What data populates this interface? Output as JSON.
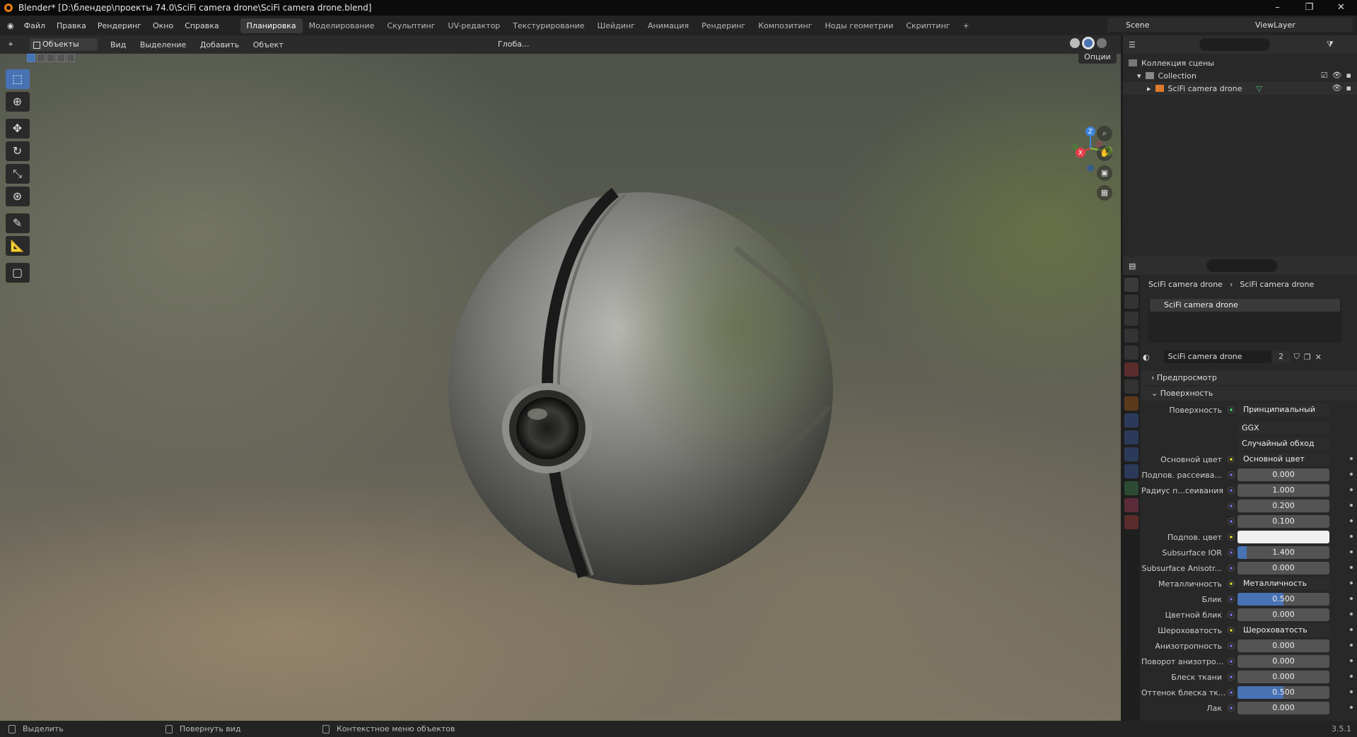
{
  "title": "Blender* [D:\\блендер\\проекты 74.0\\SciFi camera drone\\SciFi camera drone.blend]",
  "menu": [
    "Файл",
    "Правка",
    "Рендеринг",
    "Окно",
    "Справка"
  ],
  "workspaces": [
    "Планировка",
    "Моделирование",
    "Скульптинг",
    "UV-редактор",
    "Текстурирование",
    "Шейдинг",
    "Анимация",
    "Рендеринг",
    "Композитинг",
    "Ноды геометрии",
    "Скриптинг"
  ],
  "scene": "Scene",
  "view_layer": "ViewLayer",
  "viewport_header": {
    "mode": "Объекты",
    "menus": [
      "Вид",
      "Выделение",
      "Добавить",
      "Объект"
    ],
    "orientation": "Глоба...",
    "options": "Опции"
  },
  "gizmo": {
    "x": "X",
    "y": "Y",
    "z": "Z"
  },
  "outliner": {
    "root": "Коллекция сцены",
    "collection": "Collection",
    "object": "SciFi camera drone"
  },
  "properties": {
    "breadcrumb_object": "SciFi camera drone",
    "breadcrumb_material": "SciFi camera drone",
    "slot_name": "SciFi camera drone",
    "material_name": "SciFi camera drone",
    "material_users": "2",
    "panel_preview": "Предпросмотр",
    "panel_surface": "Поверхность",
    "surface_label": "Поверхность",
    "surface_value": "Принципиальный BSDF",
    "distribution": "GGX",
    "subsurface_method": "Случайный обход",
    "rows": [
      {
        "label": "Основной цвет",
        "value": "Основной цвет",
        "kind": "link"
      },
      {
        "label": "Подпов. рассеива...",
        "value": "0.000",
        "kind": "num",
        "fill": 0
      },
      {
        "label": "Радиус п...сеивания",
        "value": "1.000",
        "kind": "num",
        "fill": 0
      },
      {
        "label": "",
        "value": "0.200",
        "kind": "num",
        "fill": 0
      },
      {
        "label": "",
        "value": "0.100",
        "kind": "num",
        "fill": 0
      },
      {
        "label": "Подпов. цвет",
        "value": "",
        "kind": "color"
      },
      {
        "label": "Subsurface IOR",
        "value": "1.400",
        "kind": "num",
        "fill": 0.1
      },
      {
        "label": "Subsurface Anisotr...",
        "value": "0.000",
        "kind": "num",
        "fill": 0
      },
      {
        "label": "Металличность",
        "value": "Металличность",
        "kind": "link"
      },
      {
        "label": "Блик",
        "value": "0.500",
        "kind": "num",
        "fill": 0.5
      },
      {
        "label": "Цветной блик",
        "value": "0.000",
        "kind": "num",
        "fill": 0
      },
      {
        "label": "Шероховатость",
        "value": "Шероховатость",
        "kind": "link"
      },
      {
        "label": "Анизотропность",
        "value": "0.000",
        "kind": "num",
        "fill": 0
      },
      {
        "label": "Поворот анизотро...",
        "value": "0.000",
        "kind": "num",
        "fill": 0
      },
      {
        "label": "Блеск ткани",
        "value": "0.000",
        "kind": "num",
        "fill": 0
      },
      {
        "label": "Оттенок блеска тк...",
        "value": "0.500",
        "kind": "num",
        "fill": 0.5
      },
      {
        "label": "Лак",
        "value": "0.000",
        "kind": "num",
        "fill": 0
      }
    ]
  },
  "status": {
    "select": "Выделить",
    "rotate": "Повернуть вид",
    "context": "Контекстное меню объектов",
    "version": "3.5.1"
  },
  "colors": {
    "accent": "#4772b3",
    "x_axis": "#e63c4a",
    "y_axis": "#8ac43a",
    "z_axis": "#3b82d9"
  }
}
